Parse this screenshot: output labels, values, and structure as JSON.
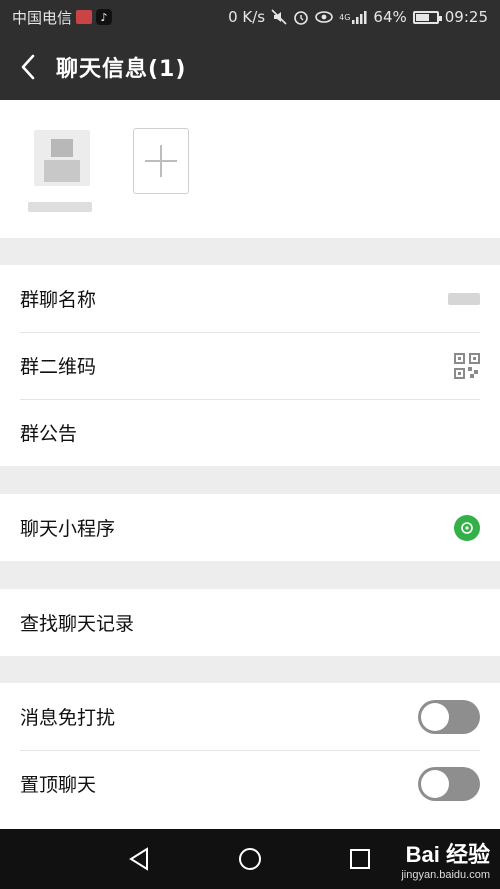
{
  "status_bar": {
    "carrier": "中国电信",
    "net_speed": "0 K/s",
    "network": "4G",
    "battery": "64%",
    "battery_level": 0.64,
    "time": "09:25"
  },
  "header": {
    "back_icon": "chevron-left-icon",
    "title": "聊天信息(1)"
  },
  "members": {
    "add_icon": "plus-icon"
  },
  "info_section": {
    "items": [
      {
        "label": "群聊名称"
      },
      {
        "label": "群二维码",
        "icon": "qr-code-icon"
      },
      {
        "label": "群公告"
      }
    ]
  },
  "miniprogram_section": {
    "label": "聊天小程序",
    "icon": "miniprogram-icon",
    "icon_color": "#33b048"
  },
  "search_section": {
    "label": "查找聊天记录"
  },
  "settings_section": {
    "items": [
      {
        "label": "消息免打扰",
        "enabled": false
      },
      {
        "label": "置顶聊天",
        "enabled": false
      }
    ]
  },
  "watermark": {
    "main": "Bai 经验",
    "sub": "jingyan.baidu.com"
  }
}
